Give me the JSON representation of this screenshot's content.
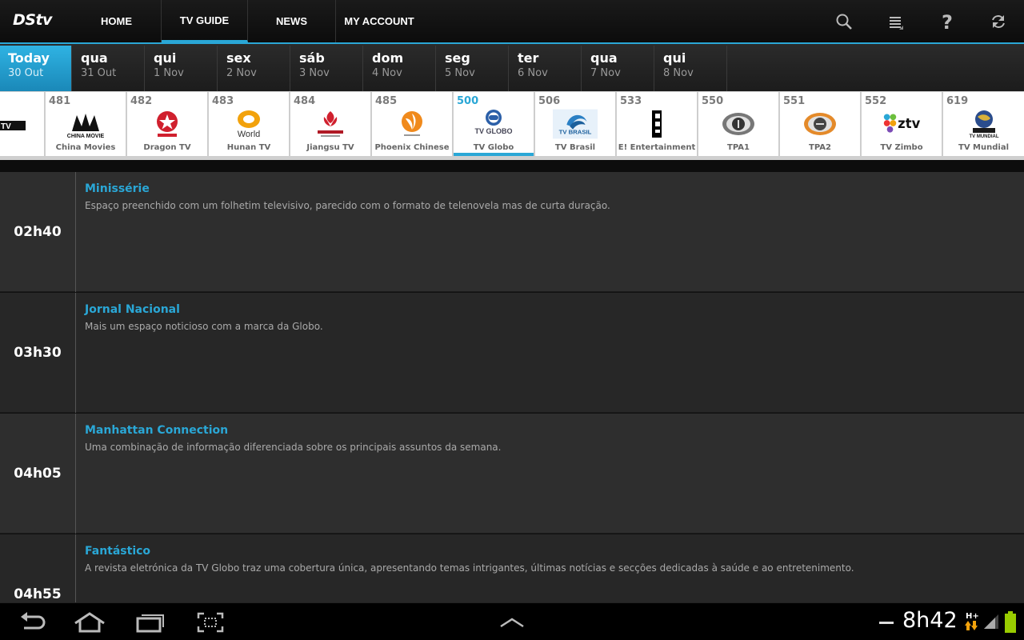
{
  "app": {
    "logo_text": "DStv"
  },
  "header": {
    "tabs": [
      {
        "label": "HOME",
        "active": false
      },
      {
        "label": "TV GUIDE",
        "active": true
      },
      {
        "label": "NEWS",
        "active": false
      },
      {
        "label": "MY ACCOUNT",
        "active": false
      }
    ],
    "icons": [
      "search-icon",
      "menu-icon",
      "help-icon",
      "refresh-icon"
    ],
    "accent_color": "#2aa7d6"
  },
  "days": [
    {
      "name": "Today",
      "date": "30 Out",
      "active": true
    },
    {
      "name": "qua",
      "date": "31 Out"
    },
    {
      "name": "qui",
      "date": "1 Nov"
    },
    {
      "name": "sex",
      "date": "2 Nov"
    },
    {
      "name": "sáb",
      "date": "3 Nov"
    },
    {
      "name": "dom",
      "date": "4 Nov"
    },
    {
      "name": "seg",
      "date": "5 Nov"
    },
    {
      "name": "ter",
      "date": "6 Nov"
    },
    {
      "name": "qua",
      "date": "7 Nov"
    },
    {
      "name": "qui",
      "date": "8 Nov"
    }
  ],
  "channels": [
    {
      "number": "481",
      "name": "China Movies",
      "logo": "china-movies-logo"
    },
    {
      "number": "482",
      "name": "Dragon TV",
      "logo": "dragon-tv-logo"
    },
    {
      "number": "483",
      "name": "Hunan TV",
      "logo": "hunan-tv-logo"
    },
    {
      "number": "484",
      "name": "Jiangsu TV",
      "logo": "jiangsu-tv-logo"
    },
    {
      "number": "485",
      "name": "Phoenix Chinese",
      "logo": "phoenix-logo"
    },
    {
      "number": "500",
      "name": "TV Globo",
      "logo": "tv-globo-logo",
      "active": true
    },
    {
      "number": "506",
      "name": "TV Brasil",
      "logo": "tv-brasil-logo"
    },
    {
      "number": "533",
      "name": "E! Entertainment",
      "logo": "e-entertainment-logo"
    },
    {
      "number": "550",
      "name": "TPA1",
      "logo": "tpa1-logo"
    },
    {
      "number": "551",
      "name": "TPA2",
      "logo": "tpa2-logo"
    },
    {
      "number": "552",
      "name": "TV Zimbo",
      "logo": "tv-zimbo-logo"
    },
    {
      "number": "619",
      "name": "TV Mundial",
      "logo": "tv-mundial-logo"
    }
  ],
  "logo_texts": {
    "china_movie": "CHINA MOVIE",
    "hunan": "World",
    "globo": "TV GLOBO",
    "brasil": "TV BRASIL",
    "zimbo": "ztv",
    "mundial": "TV MUNDIAL",
    "partial": "TV"
  },
  "programmes": [
    {
      "time": "02h40",
      "title": "Minissérie",
      "description": "Espaço preenchido com um folhetim televisivo, parecido com o formato de telenovela mas de curta duração."
    },
    {
      "time": "03h30",
      "title": "Jornal Nacional",
      "description": "Mais um espaço noticioso com a marca da Globo."
    },
    {
      "time": "04h05",
      "title": "Manhattan Connection",
      "description": "Uma combinação de informação diferenciada sobre os principais assuntos da semana."
    },
    {
      "time": "04h55",
      "title": "Fantástico",
      "description": "A revista eletrónica da TV Globo traz uma cobertura única, apresentando temas intrigantes, últimas notícias e secções dedicadas à saúde e ao entretenimento."
    }
  ],
  "status_bar": {
    "clock": "8h42",
    "network": "H+"
  }
}
